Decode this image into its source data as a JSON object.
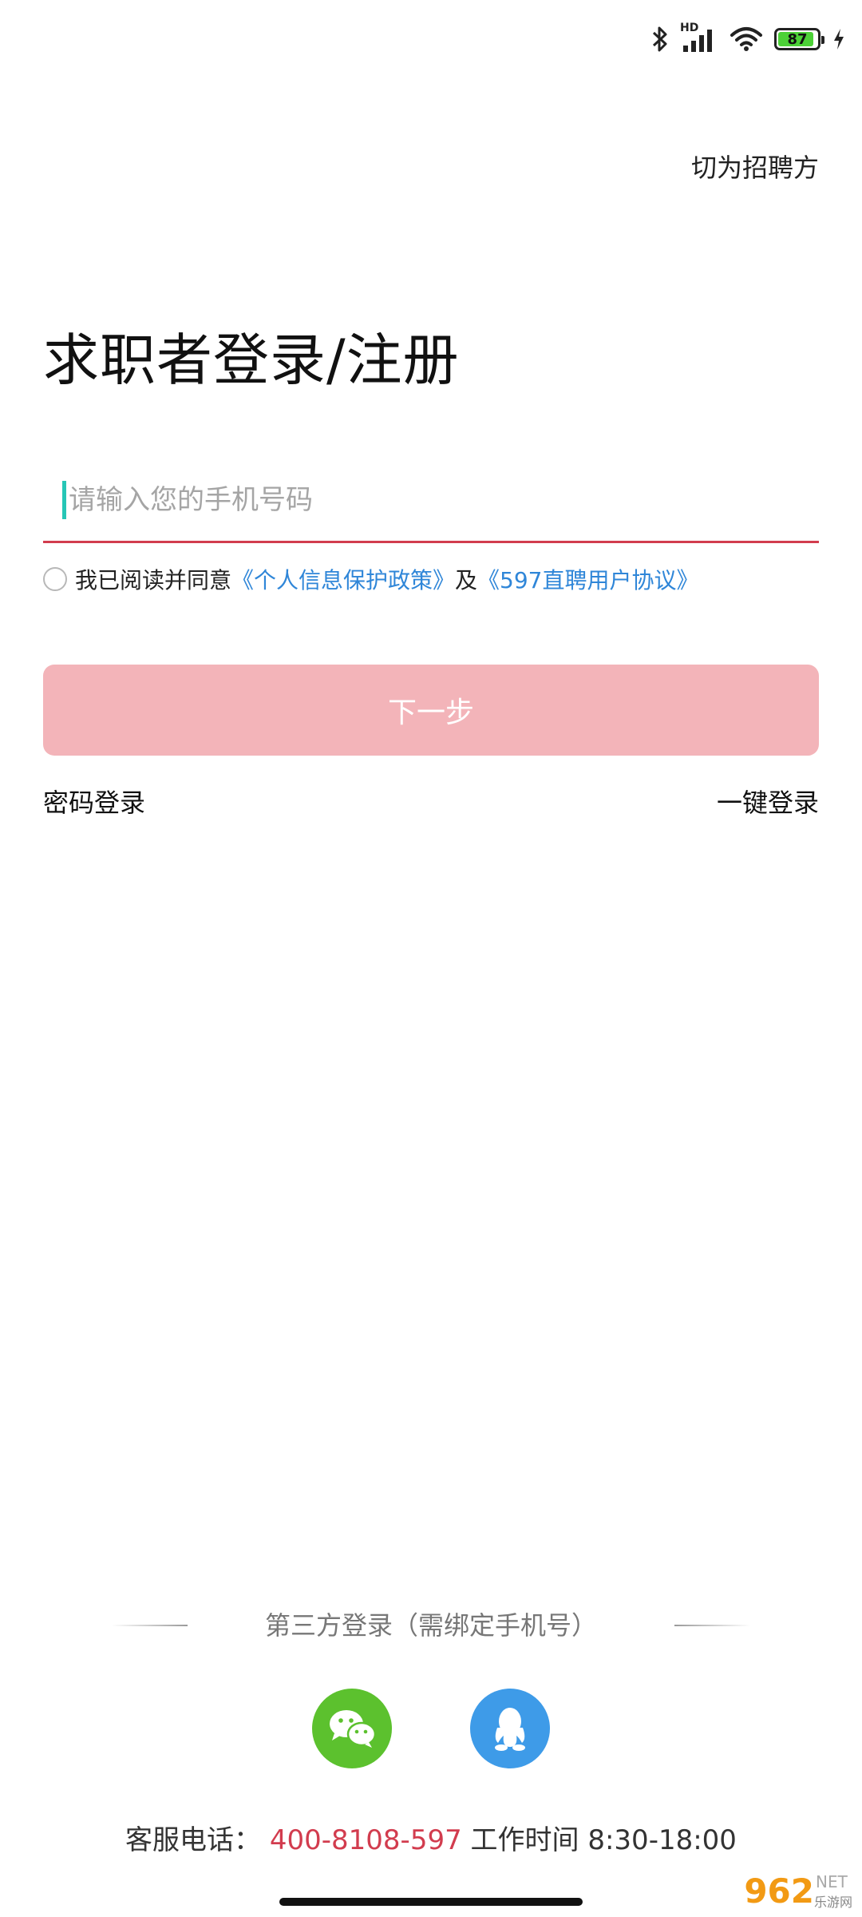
{
  "status_bar": {
    "battery_level": "87",
    "network_label": "HD",
    "icons": [
      "bluetooth-icon",
      "signal-icon",
      "wifi-icon",
      "battery-icon",
      "charging-icon"
    ]
  },
  "header": {
    "switch_role": "切为招聘方"
  },
  "login": {
    "title": "求职者登录/注册",
    "phone_placeholder": "请输入您的手机号码",
    "agree_prefix": "我已阅读并同意",
    "privacy_link": "《个人信息保护政策》",
    "agree_and": "及",
    "user_agreement_link": "《597直聘用户协议》",
    "next_button": "下一步",
    "password_login": "密码登录",
    "one_click_login": "一键登录"
  },
  "third_party": {
    "label": "第三方登录（需绑定手机号）",
    "options": [
      "wechat-icon",
      "qq-icon"
    ]
  },
  "service": {
    "label": "客服电话：",
    "phone": "400-8108-597",
    "hours": " 工作时间 8:30-18:00"
  },
  "watermark": {
    "number": "962",
    "suffix": "NET",
    "sub": "乐游网"
  },
  "colors": {
    "accent": "#d23c4e",
    "button_disabled": "#f3b4b9",
    "link": "#2f86d8",
    "cursor": "#26c6b6",
    "wechat": "#5cc12e",
    "qq": "#3e9be8"
  }
}
